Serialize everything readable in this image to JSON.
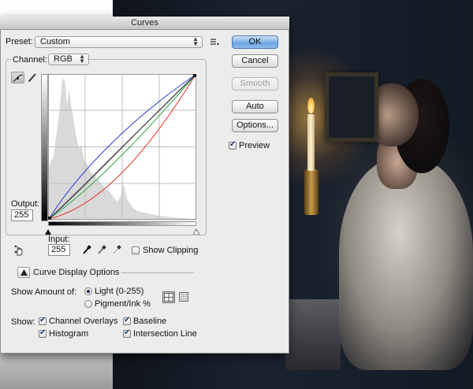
{
  "dialog": {
    "title": "Curves",
    "preset_label": "Preset:",
    "preset_value": "Custom",
    "channel_label": "Channel:",
    "channel_value": "RGB",
    "output_label": "Output:",
    "output_value": "255",
    "input_label": "Input:",
    "input_value": "255",
    "show_clipping": "Show Clipping",
    "curve_display_options": "Curve Display Options",
    "show_amount_label": "Show Amount of:",
    "light_option": "Light  (0-255)",
    "pigment_option": "Pigment/Ink %",
    "show_label": "Show:",
    "channel_overlays": "Channel Overlays",
    "baseline": "Baseline",
    "histogram": "Histogram",
    "intersection_line": "Intersection Line"
  },
  "buttons": {
    "ok": "OK",
    "cancel": "Cancel",
    "smooth": "Smooth",
    "auto": "Auto",
    "options": "Options...",
    "preview": "Preview"
  },
  "state": {
    "preview_checked": true,
    "show_clipping_checked": false,
    "light_selected": true,
    "channel_overlays_checked": true,
    "baseline_checked": true,
    "histogram_checked": true,
    "intersection_line_checked": true
  },
  "colors": {
    "curve_red": "#e0302a",
    "curve_green": "#2aa84a",
    "curve_blue": "#2a3fd0",
    "curve_rgb": "#222222",
    "ok_button": "#6fa6e0"
  },
  "icons": {
    "curve_tool": "curve-point-icon",
    "pencil_tool": "pencil-icon",
    "targeted_adjust": "hand-adjust-icon",
    "black_eyedropper": "eyedropper-black-icon",
    "gray_eyedropper": "eyedropper-gray-icon",
    "white_eyedropper": "eyedropper-white-icon",
    "preset_menu": "preset-options-icon",
    "simple_grid": "grid-4x4-icon",
    "detailed_grid": "grid-10x10-icon"
  }
}
